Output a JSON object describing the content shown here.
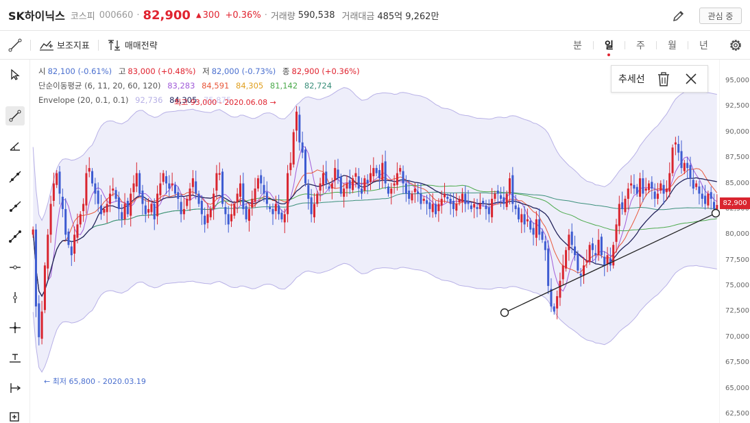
{
  "header": {
    "stock_name": "SK하이닉스",
    "market": "코스피",
    "code": "000660",
    "price": "82,900",
    "change": "300",
    "change_pct": "+0.36%",
    "volume_label": "거래량",
    "volume": "590,538",
    "amount_label": "거래대금",
    "amount": "485억 9,262만",
    "favorite_label": "관심 중",
    "up_color": "#e0232f"
  },
  "toolbar": {
    "indicator_label": "보조지표",
    "strategy_label": "매매전략",
    "periods": [
      "분",
      "일",
      "주",
      "월",
      "년"
    ],
    "active_period": "일"
  },
  "legend": {
    "ohlc": {
      "open_label": "시",
      "open": "82,100 (-0.61%)",
      "high_label": "고",
      "high": "83,000 (+0.48%)",
      "low_label": "저",
      "low": "82,000 (-0.73%)",
      "close_label": "종",
      "close": "82,900 (+0.36%)"
    },
    "ma": {
      "label": "단순이동평균 (6, 11, 20, 60, 120)",
      "values": [
        "83,283",
        "84,591",
        "84,305",
        "81,142",
        "82,724"
      ],
      "colors": [
        "#a15cd9",
        "#e8573a",
        "#e0a020",
        "#4caa4c",
        "#3a8f7a"
      ]
    },
    "envelope": {
      "label": "Envelope (20, 0.1, 0.1)",
      "values": [
        "92,736",
        "84,305",
        "75,875"
      ],
      "colors": [
        "#b7b0e6",
        "#22225a",
        "#b7b0e6"
      ]
    }
  },
  "annotations": {
    "high": "최고 93,000 - 2020.06.08 →",
    "low": "← 최저 65,800 - 2020.03.19"
  },
  "trendline_panel": {
    "label": "추세선"
  },
  "current_price_tag": "82,900",
  "chart_data": {
    "type": "candlestick",
    "title": "SK하이닉스",
    "y_axis_ticks": [
      95000,
      92500,
      90000,
      87500,
      85000,
      82500,
      80000,
      77500,
      75000,
      72500,
      70000,
      67500,
      65000,
      62500
    ],
    "y_axis_labels": [
      "95,000",
      "92,500",
      "90,000",
      "87,500",
      "85,000",
      "82,500",
      "80,000",
      "77,500",
      "75,000",
      "72,500",
      "70,000",
      "67,500",
      "65,000",
      "62,500"
    ],
    "ylim": [
      62000,
      96000
    ],
    "closes": [
      80500,
      73000,
      70000,
      72500,
      77000,
      80000,
      83000,
      85000,
      86000,
      84000,
      82500,
      80000,
      79000,
      78000,
      80000,
      81000,
      82000,
      83000,
      86000,
      86500,
      85000,
      84000,
      83000,
      82000,
      82500,
      83000,
      84000,
      84500,
      83500,
      82500,
      81500,
      83000,
      82000,
      84000,
      85000,
      86000,
      84000,
      83000,
      82000,
      82500,
      83000,
      81500,
      84000,
      85000,
      86000,
      85000,
      84500,
      85000,
      84000,
      83500,
      82000,
      82500,
      83500,
      84500,
      85500,
      84000,
      83000,
      82000,
      81000,
      82000,
      82500,
      84000,
      86000,
      86000,
      83000,
      82000,
      81000,
      82000,
      83000,
      84000,
      85000,
      82500,
      81500,
      82500,
      83500,
      84500,
      85500,
      85000,
      84000,
      83000,
      82500,
      82000,
      83000,
      82000,
      81500,
      82000,
      86000,
      87000,
      90000,
      92000,
      89000,
      88000,
      85000,
      83500,
      82000,
      83000,
      84000,
      85000,
      86000,
      85000,
      84500,
      85000,
      86500,
      85500,
      84000,
      84500,
      85000,
      84500,
      85500,
      86000,
      84500,
      84000,
      85500,
      85000,
      86000,
      86500,
      86000,
      85500,
      87000,
      85000,
      84000,
      84500,
      85000,
      86000,
      86500,
      85000,
      84000,
      83500,
      84000,
      84500,
      84000,
      83000,
      83500,
      83000,
      82500,
      83000,
      82000,
      83000,
      83500,
      84000,
      83500,
      83000,
      82500,
      83000,
      83500,
      84000,
      83000,
      83000,
      82500,
      83000,
      82500,
      83000,
      83000,
      82500,
      82000,
      83500,
      84000,
      84000,
      83500,
      83000,
      84000,
      85500,
      83000,
      82500,
      81500,
      82000,
      81000,
      81500,
      80500,
      80000,
      81500,
      80000,
      79500,
      78500,
      75000,
      73000,
      72500,
      74000,
      75500,
      77000,
      78500,
      80000,
      79000,
      78000,
      76500,
      76000,
      77000,
      77500,
      79000,
      78500,
      78000,
      79500,
      78000,
      77000,
      78000,
      77000,
      79000,
      81000,
      83000,
      82500,
      83500,
      84500,
      85000,
      84500,
      84000,
      85500,
      84000,
      84500,
      85000,
      84500,
      83500,
      84000,
      85000,
      84000,
      84500,
      86000,
      88500,
      89000,
      88000,
      86500,
      87000,
      86500,
      85500,
      84500,
      85000,
      84000,
      83500,
      83000,
      84000,
      83500,
      82500,
      82900
    ],
    "ma_periods": [
      6,
      11,
      20,
      60,
      120
    ],
    "trendline": {
      "from": 72500,
      "to": 82200
    }
  }
}
